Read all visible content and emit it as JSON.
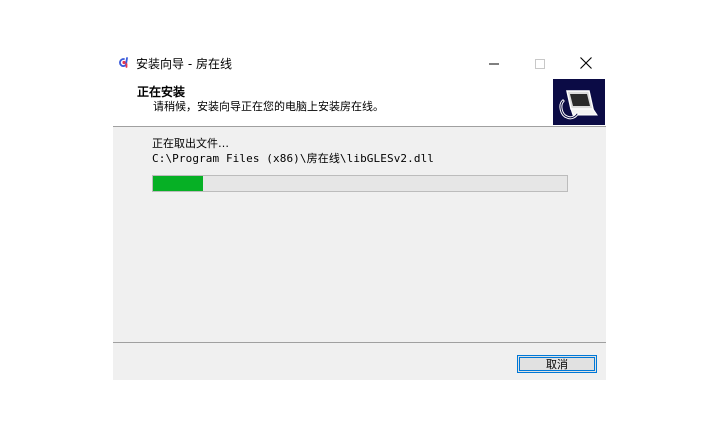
{
  "window": {
    "title": "安装向导 - 房在线"
  },
  "header": {
    "title": "正在安装",
    "subtitle": "请稍候，安装向导正在您的电脑上安装房在线。"
  },
  "progress": {
    "status": "正在取出文件…",
    "file_path": "C:\\Program Files (x86)\\房在线\\libGLESv2.dll",
    "fraction": 0.12
  },
  "buttons": {
    "cancel": "取消"
  },
  "icons": {
    "app": "app-logo-icon",
    "minimize": "minimize-icon",
    "maximize": "maximize-icon",
    "close": "close-icon",
    "installer": "installer-computer-icon"
  },
  "colors": {
    "progress_fill": "#06b025",
    "focus_border": "#0078d7",
    "header_logo_bg": "#0b0b45"
  }
}
